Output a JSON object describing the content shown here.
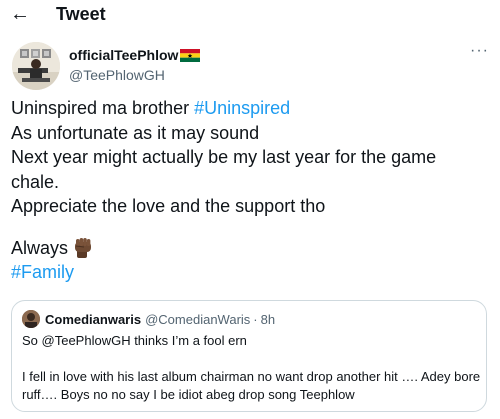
{
  "header": {
    "title": "Tweet",
    "back_icon": "arrow-left-icon"
  },
  "author": {
    "display_name": "officialTeePhlow",
    "flag_icon": "ghana-flag-icon",
    "handle": "@TeePhlowGH"
  },
  "more_icon": "ellipsis-icon",
  "more_label": "···",
  "tweet": {
    "lines": [
      {
        "text": "Uninspired ma brother ",
        "hashtag": "#Uninspired"
      },
      {
        "text": "As unfortunate as it may sound"
      },
      {
        "text": "Next year might actually be my last year for the game"
      },
      {
        "text": "chale."
      },
      {
        "text": "Appreciate the love and the support tho"
      }
    ],
    "always": "Always",
    "emoji_icon": "raised-fist-icon",
    "final_hashtag": "#Family"
  },
  "quote": {
    "display_name": "Comedianwaris",
    "handle": "@ComedianWaris",
    "separator": "·",
    "time": "8h",
    "lines": [
      "So @TeePhlowGH  thinks I’m a fool ern",
      "",
      "I fell in love with his last album chairman no want drop another hit …. Adey bore",
      "ruff…. Boys no no say I be idiot abeg drop song Teephlow"
    ]
  },
  "colors": {
    "accent": "#1d9bf0",
    "text": "#0f1419",
    "secondary_text": "#536471",
    "border": "#cfd9de",
    "background": "#ffffff"
  }
}
